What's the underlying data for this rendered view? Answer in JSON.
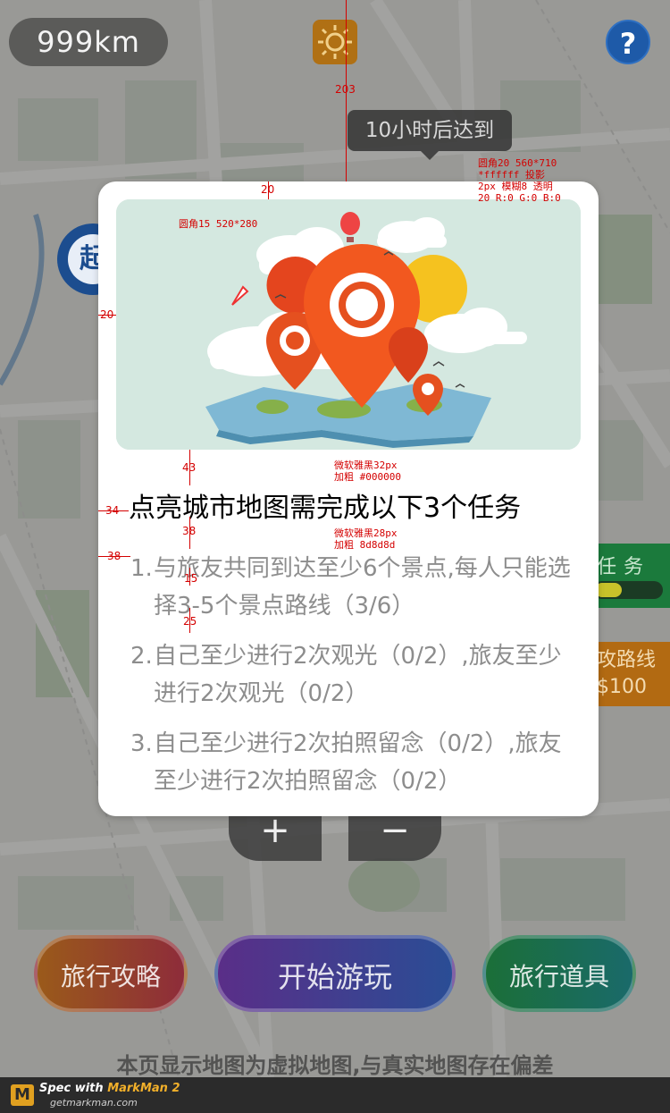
{
  "top_bar": {
    "distance": "999km",
    "help_label": "?",
    "arrive_text": "10小时后达到"
  },
  "map": {
    "start_marker": "起",
    "task_widget_label": "任务",
    "route_widget_label": "攻路线",
    "route_widget_value": "$100",
    "zoom_in_label": "+",
    "zoom_out_label": "−"
  },
  "modal": {
    "title": "点亮城市地图需完成以下3个任务",
    "tasks": [
      {
        "num": "1.",
        "text": "与旅友共同到达至少6个景点,每人只能选择3-5个景点路线（3/6）"
      },
      {
        "num": "2.",
        "text": "自己至少进行2次观光（0/2）,旅友至少进行2次观光（0/2）"
      },
      {
        "num": "3.",
        "text": "自己至少进行2次拍照留念（0/2）,旅友至少进行2次拍照留念（0/2）"
      }
    ]
  },
  "bottom": {
    "guide_label": "旅行攻略",
    "start_label": "开始游玩",
    "props_label": "旅行道具",
    "disclaimer": "本页显示地图为虚拟地图,与真实地图存在偏差"
  },
  "annotations": {
    "top_gap": "203",
    "modal_spec": "圆角20 560*710\n*ffffff 投影\n2px 模糊8 透明\n20 R:0 G:0 B:0",
    "image_spec": "圆角15 520*280",
    "image_top": "20",
    "image_left": "20",
    "gap_image_title": "43",
    "title_left": "34",
    "title_font": "微软雅黑32px\n加粗 #000000",
    "gap_title_list": "38",
    "list_left": "38",
    "list_font": "微软雅黑28px\n加粗 8d8d8d",
    "line_gap": "15",
    "item_gap": "25"
  },
  "footer": {
    "logo": "M",
    "spec_prefix": "Spec with ",
    "spec_brand": "MarkMan 2",
    "site": "getmarkman.com"
  },
  "colors": {
    "modal_bg": "#ffffff",
    "title_color": "#000000",
    "task_color": "#8d8d8d",
    "annotation": "#d40000"
  }
}
